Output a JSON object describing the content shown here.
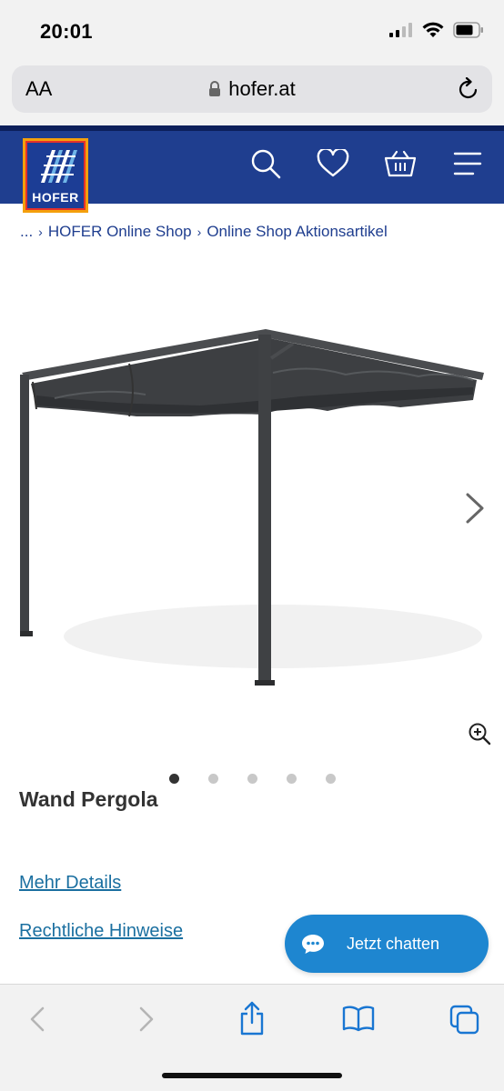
{
  "status": {
    "time": "20:01"
  },
  "browser": {
    "aa_label": "AA",
    "url": "hofer.at"
  },
  "header": {
    "logo_text": "HOFER"
  },
  "breadcrumb": {
    "ellipsis": "...",
    "items": [
      "HOFER Online Shop",
      "Online Shop Aktionsartikel"
    ]
  },
  "product": {
    "title": "Wand Pergola",
    "gallery": {
      "image_count": 5,
      "active_index": 0
    }
  },
  "links": {
    "details": "Mehr Details",
    "legal": "Rechtliche Hinweise"
  },
  "chat": {
    "label": "Jetzt chatten"
  },
  "colors": {
    "brand_blue": "#1f3e8f",
    "accent_orange": "#f4a00c",
    "link": "#1a6fa0",
    "chat": "#1e86d0"
  },
  "icons": [
    "lock-icon",
    "reload-icon",
    "search-icon",
    "heart-icon",
    "basket-icon",
    "menu-icon",
    "chevron-right-icon",
    "zoom-in-icon",
    "chat-bubble-icon",
    "back-icon",
    "forward-icon",
    "share-icon",
    "bookmarks-icon",
    "tabs-icon"
  ]
}
